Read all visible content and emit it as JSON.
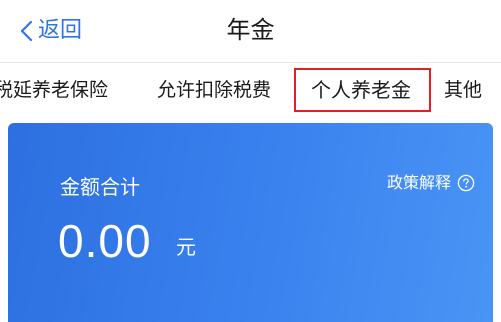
{
  "header": {
    "back_label": "返回",
    "title": "年金"
  },
  "tabs": [
    {
      "label": "税延养老保险"
    },
    {
      "label": "允许扣除税费"
    },
    {
      "label": "个人养老金",
      "selected": true
    },
    {
      "label": "其他"
    }
  ],
  "card": {
    "amount_label": "金额合计",
    "policy_label": "政策解释",
    "amount_value": "0.00",
    "amount_unit": "元"
  },
  "colors": {
    "accent": "#2f74e8",
    "card_gradient_start": "#2d6fe0",
    "card_gradient_end": "#4a94f5",
    "highlight_border": "#e02121"
  },
  "icons": {
    "back": "chevron-left-icon",
    "help": "question-circle-icon"
  }
}
